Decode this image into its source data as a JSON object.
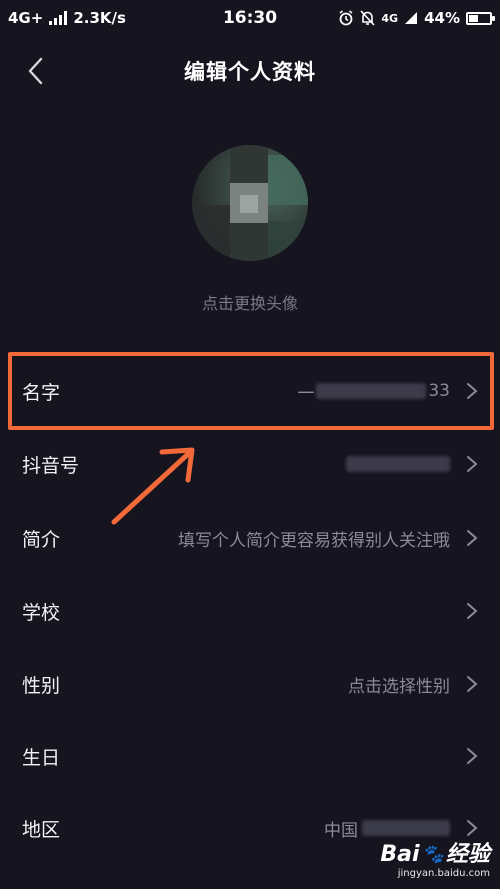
{
  "status_bar": {
    "network": "4G+",
    "speed": "2.3K/s",
    "time": "16:30",
    "network_right": "4G",
    "battery": "44%",
    "battery_level": 0.44
  },
  "header": {
    "title": "编辑个人资料"
  },
  "avatar": {
    "hint": "点击更换头像"
  },
  "rows": [
    {
      "label": "名字",
      "value_prefix": "一",
      "value_suffix": "33"
    },
    {
      "label": "抖音号",
      "value": ""
    },
    {
      "label": "简介",
      "value": "填写个人简介更容易获得别人关注哦"
    },
    {
      "label": "学校",
      "value": ""
    },
    {
      "label": "性别",
      "value": "点击选择性别"
    },
    {
      "label": "生日",
      "value": ""
    },
    {
      "label": "地区",
      "value_prefix": "中国"
    }
  ],
  "watermark": {
    "brand_left": "Bai",
    "brand_right": "经验",
    "url": "jingyan.baidu.com"
  },
  "colors": {
    "background": "#15141f",
    "highlight": "#f26a3a",
    "secondary_text": "#8c8a99"
  }
}
